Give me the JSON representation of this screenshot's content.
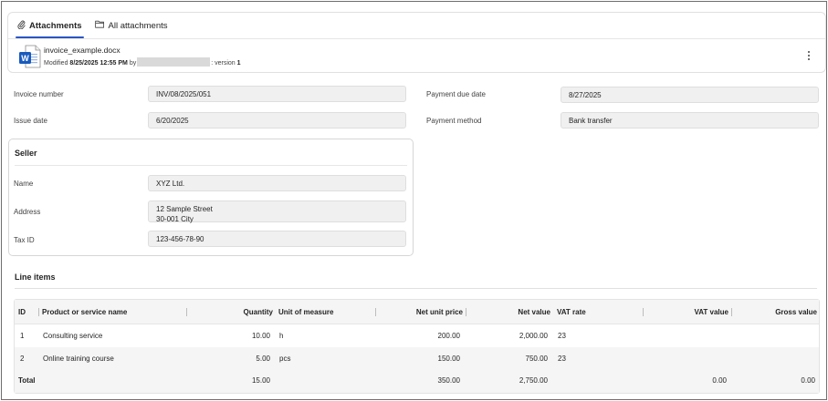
{
  "tabs": [
    {
      "label": "Attachments",
      "icon": "paperclip-icon",
      "active": true
    },
    {
      "label": "All attachments",
      "icon": "folder-icon",
      "active": false
    }
  ],
  "file": {
    "name": "invoice_example.docx",
    "icon": "word-document-icon",
    "modified_prefix": "Modified",
    "modified_date": "8/25/2025 12:55 PM",
    "by_label": "by",
    "version_label": "version",
    "version": "1"
  },
  "fields": {
    "invoice_number": {
      "label": "Invoice number",
      "value": "INV/08/2025/051"
    },
    "issue_date": {
      "label": "Issue date",
      "value": "6/20/2025"
    },
    "payment_due_date": {
      "label": "Payment due date",
      "value": "8/27/2025"
    },
    "payment_method": {
      "label": "Payment method",
      "value": "Bank transfer"
    }
  },
  "seller": {
    "title": "Seller",
    "name": {
      "label": "Name",
      "value": "XYZ Ltd."
    },
    "address": {
      "label": "Address",
      "line1": "12 Sample Street",
      "line2": "30-001 City"
    },
    "tax_id": {
      "label": "Tax ID",
      "value": "123-456-78-90"
    }
  },
  "line_items": {
    "title": "Line items",
    "headers": {
      "id": "ID",
      "name": "Product or service name",
      "quantity": "Quantity",
      "unit": "Unit of measure",
      "net_unit_price": "Net unit price",
      "net_value": "Net value",
      "vat_rate": "VAT rate",
      "vat_value": "VAT value",
      "gross_value": "Gross value"
    },
    "rows": [
      {
        "id": "1",
        "name": "Consulting service",
        "quantity": "10.00",
        "unit": "h",
        "net_unit_price": "200.00",
        "net_value": "2,000.00",
        "vat_rate": "23"
      },
      {
        "id": "2",
        "name": "Online training course",
        "quantity": "5.00",
        "unit": "pcs",
        "net_unit_price": "150.00",
        "net_value": "750.00",
        "vat_rate": "23"
      }
    ],
    "total": {
      "label": "Total",
      "quantity": "15.00",
      "net_unit_price": "350.00",
      "net_value": "2,750.00",
      "vat_value": "0.00",
      "gross_value": "0.00"
    }
  },
  "colors": {
    "accent": "#2a55c4",
    "word_blue": "#185abd",
    "field_bg": "#f0f0f0"
  }
}
